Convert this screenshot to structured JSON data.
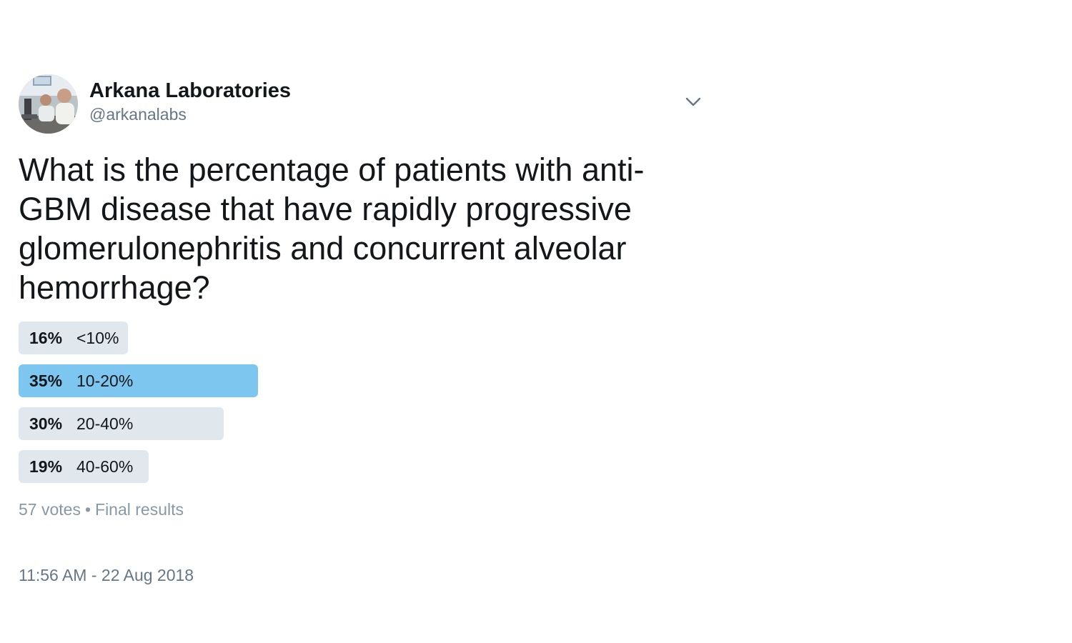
{
  "author": {
    "display_name": "Arkana Laboratories",
    "handle": "@arkanalabs",
    "avatar_icon": "lab-photo-avatar"
  },
  "menu": {
    "icon": "chevron-down-icon"
  },
  "tweet": {
    "text": "What is the percentage of patients with anti-GBM disease that have rapidly progressive glomerulonephritis and concurrent alveolar hemorrhage?"
  },
  "poll": {
    "options": [
      {
        "percent_label": "16%",
        "percent": 16,
        "choice": "<10%",
        "winner": false
      },
      {
        "percent_label": "35%",
        "percent": 35,
        "choice": "10-20%",
        "winner": true
      },
      {
        "percent_label": "30%",
        "percent": 30,
        "choice": "20-40%",
        "winner": false
      },
      {
        "percent_label": "19%",
        "percent": 19,
        "choice": "40-60%",
        "winner": false
      }
    ],
    "votes": "57 votes",
    "separator": "•",
    "status": "Final results"
  },
  "timestamp": "11:56 AM - 22 Aug 2018",
  "colors": {
    "winner_bar": "#7dc6ef",
    "bar": "#e1e8ed",
    "secondary_text": "#657786"
  }
}
